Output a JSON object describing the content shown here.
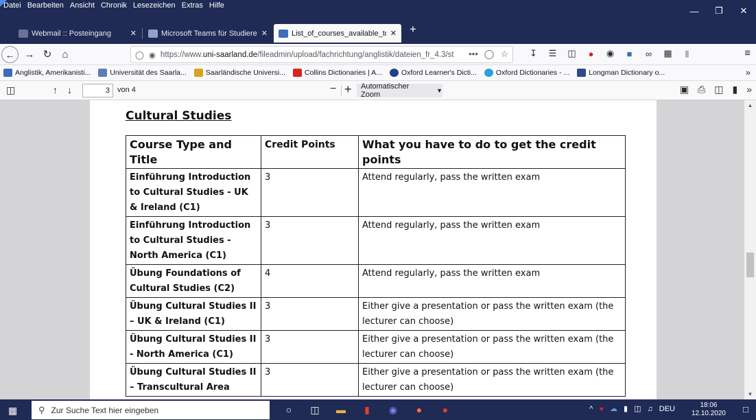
{
  "menu": [
    "Datei",
    "Bearbeiten",
    "Ansicht",
    "Chronik",
    "Lesezeichen",
    "Extras",
    "Hilfe"
  ],
  "tabs": [
    {
      "label": "Webmail :: Posteingang",
      "icon": "mail-icon",
      "color": "#6a7394"
    },
    {
      "label": "Microsoft Teams für Studierend",
      "icon": "teams-icon",
      "color": "#8fa3c9"
    },
    {
      "label": "List_of_courses_available_to_Er",
      "icon": "pdf-icon",
      "color": "#3d6fb8"
    }
  ],
  "new_tab_glyph": "+",
  "navbar": {
    "url_prefix": "https://www.",
    "url_host": "uni-saarland.de",
    "url_path": "/fileadmin/upload/fachrichtung/anglistik/dateien_fr_4.3/st",
    "url_more": "•••"
  },
  "bookmarks": [
    {
      "label": "Anglistik, Amerikanisti...",
      "color": "#3d6fb8"
    },
    {
      "label": "Universität des Saarla...",
      "color": "#5a7fb5"
    },
    {
      "label": "Saarländische Universi...",
      "color": "#d9a21b"
    },
    {
      "label": "Collins Dictionaries | A...",
      "color": "#d8251d"
    },
    {
      "label": "Oxford Learner's Dicti...",
      "color": "#1f3f8f"
    },
    {
      "label": "Oxford Dictionaries - ...",
      "color": "#2a9fd8"
    },
    {
      "label": "Longman Dictionary o...",
      "color": "#2e4a8a"
    }
  ],
  "pdf_toolbar": {
    "page_number": "3",
    "page_of": "von 4",
    "zoom_label": "Automatischer Zoom"
  },
  "document": {
    "heading": "Cultural Studies",
    "headers": [
      "Course Type and Title",
      "Credit Points",
      "What you have to do to get the credit points"
    ],
    "rows": [
      {
        "title": "Einführung Introduction to Cultural Studies - UK & Ireland (C1)",
        "credits": "3",
        "requirement": "Attend regularly, pass the written exam"
      },
      {
        "title": "Einführung Introduction to Cultural Studies - North America (C1)",
        "credits": "3",
        "requirement": "Attend regularly, pass the written exam"
      },
      {
        "title": "Übung Foundations of Cultural Studies (C2)",
        "credits": "4",
        "requirement": "Attend regularly, pass the written exam"
      },
      {
        "title": "Übung Cultural Studies II – UK & Ireland (C1)",
        "credits": "3",
        "requirement": "Either give a presentation or pass the written exam (the lecturer can choose)"
      },
      {
        "title": "Übung Cultural Studies II - North America (C1)",
        "credits": "3",
        "requirement": "Either give a presentation or pass the written exam (the lecturer can choose)"
      },
      {
        "title": "Übung Cultural Studies II – Transcultural Area",
        "credits": "3",
        "requirement": "Either give a presentation or pass the written exam (the lecturer can choose)"
      }
    ]
  },
  "taskbar": {
    "search_placeholder": "Zur Suche Text hier eingeben",
    "language": "DEU",
    "time": "18:06",
    "date": "12.10.2020"
  }
}
